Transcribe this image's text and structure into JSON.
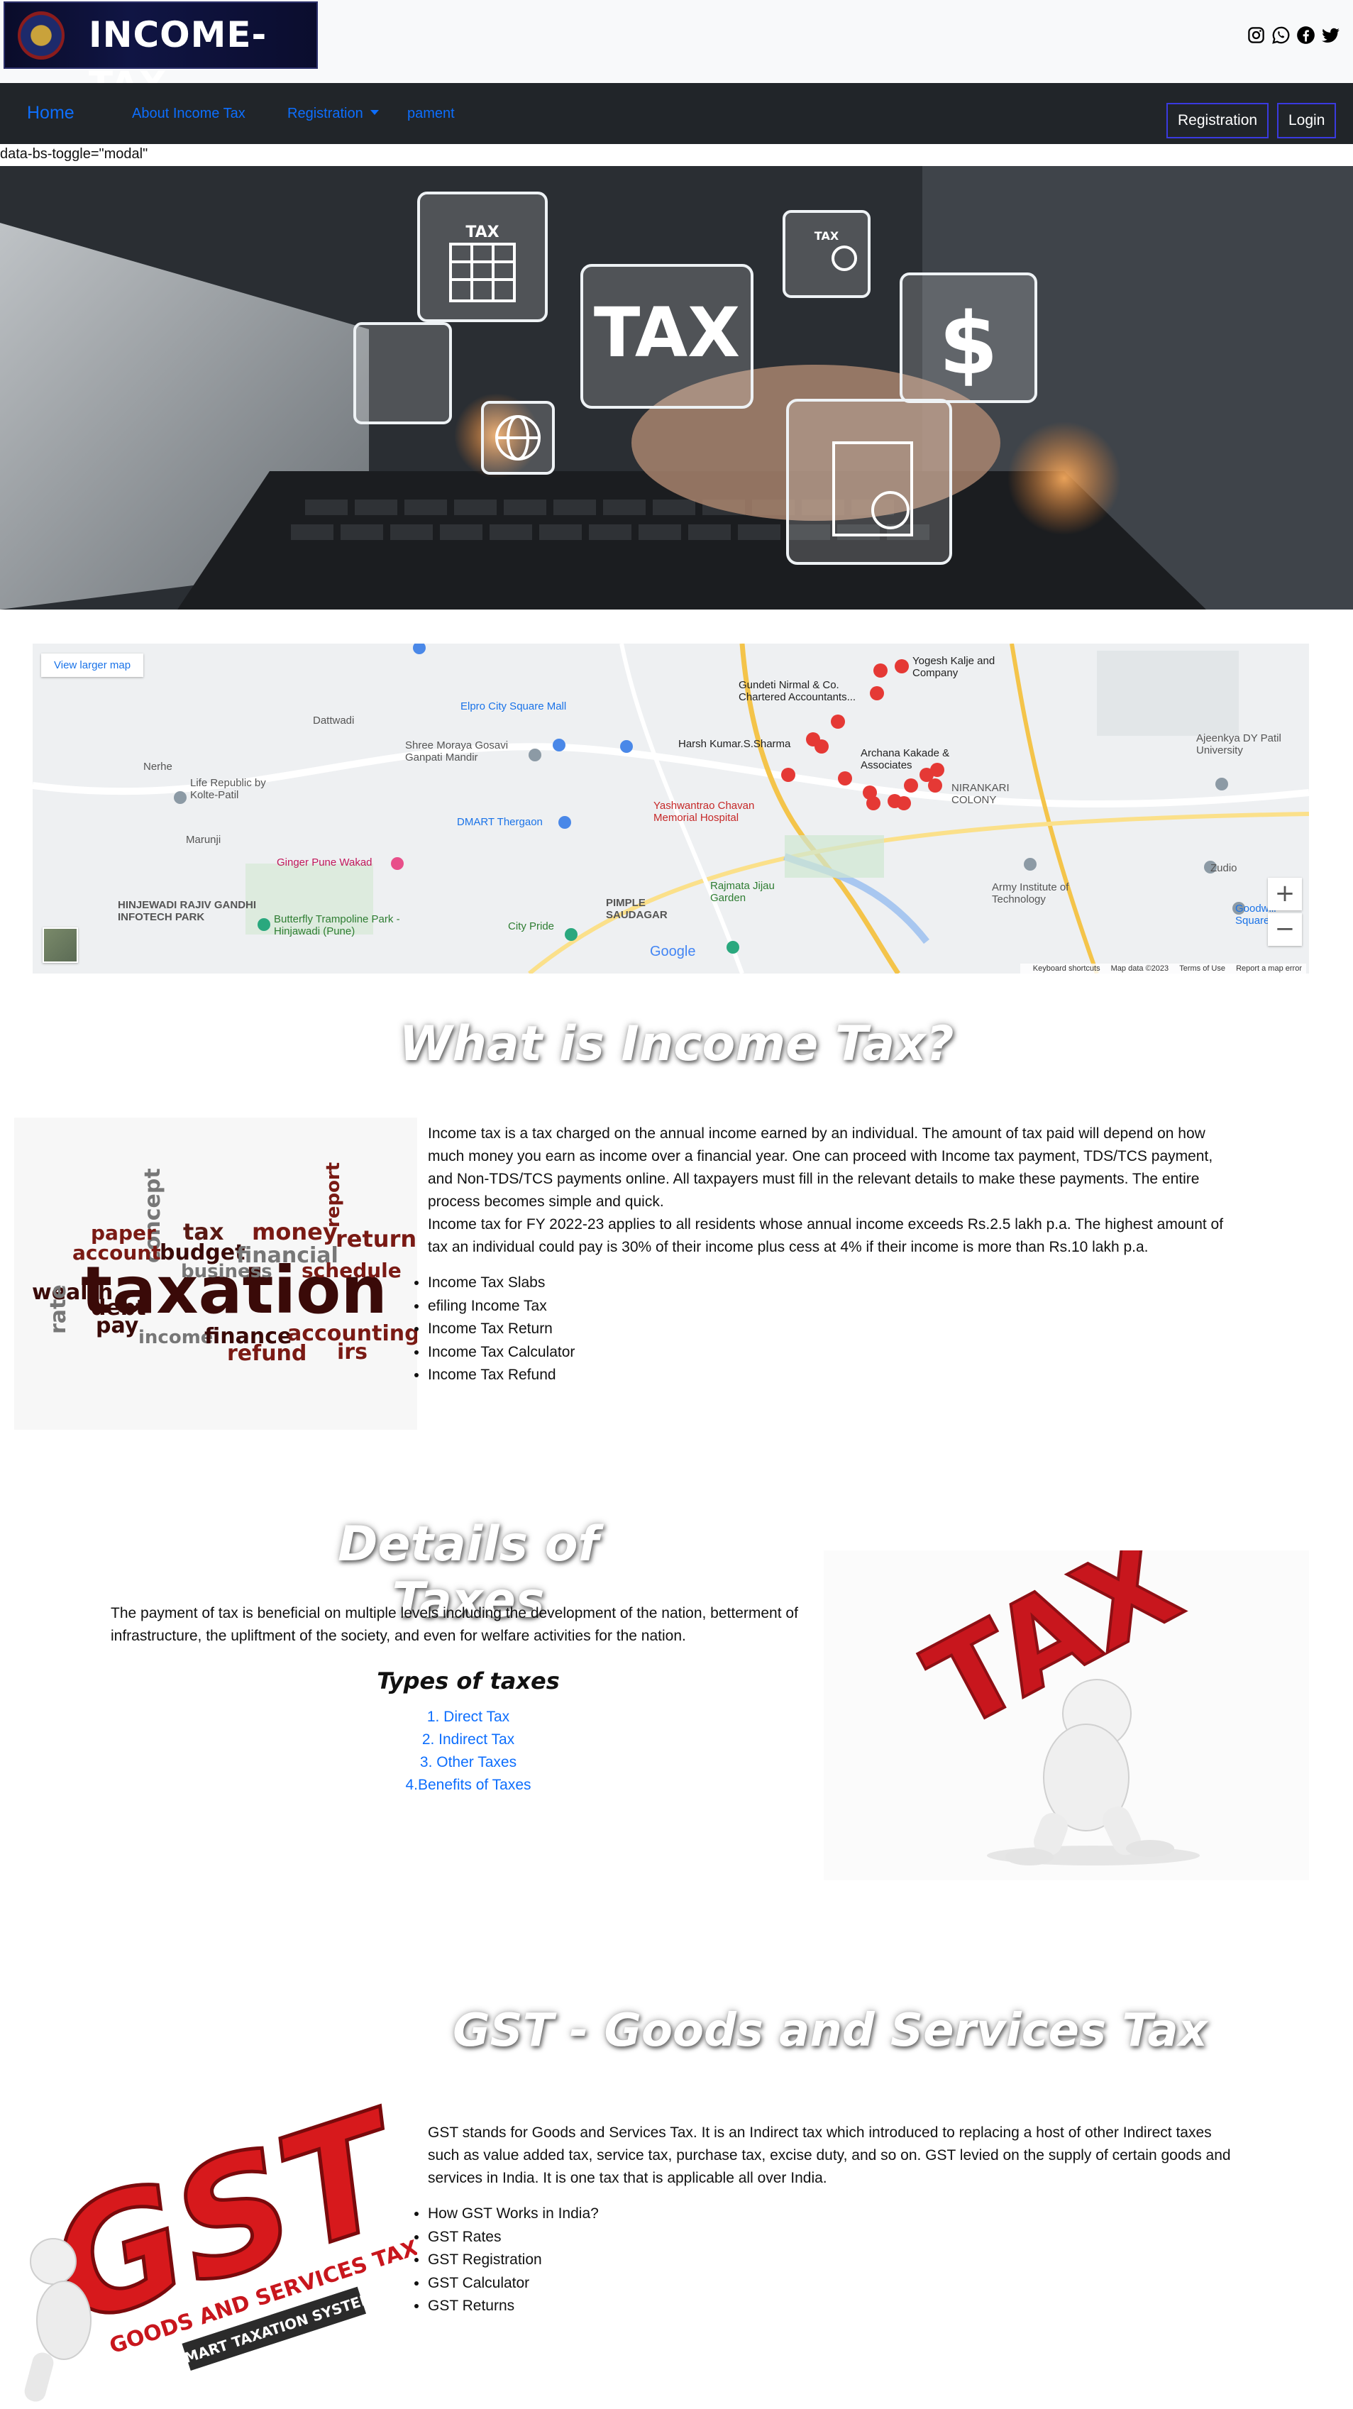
{
  "header": {
    "logo_text": "INCOME-TAX",
    "social_icons": [
      "instagram-icon",
      "whatsapp-icon",
      "facebook-icon",
      "twitter-icon"
    ]
  },
  "nav": {
    "home": "Home",
    "about": "About Income Tax",
    "registration": "Registration",
    "payment": "pament",
    "register_button": "Registration",
    "login_button": "Login"
  },
  "stray_text": "data-bs-toggle=\"modal\"",
  "hero": {
    "icon_labels": [
      "TAX",
      "TAX",
      "TAX",
      "$"
    ]
  },
  "map": {
    "view_larger": "View larger map",
    "labels": [
      "Dattwadi",
      "Nerhe",
      "Life Republic by Kolte-Patil",
      "Marunji",
      "HINJEWADI RAJIV GANDHI INFOTECH PARK",
      "Ginger Pune Wakad",
      "DMART Thergaon",
      "Elpro City Square Mall",
      "Shree Moraya Gosavi Ganpati Mandir",
      "Harsh Kumar.S.Sharma",
      "Gundeti Nirmal & Co. Chartered Accountants...",
      "Yogesh Kalje and Company",
      "Archana Kakade & Associates",
      "Yashwantrao Chavan Memorial Hospital",
      "PIMPLE SAUDAGAR",
      "Rajmata Jijau Garden",
      "City Pride",
      "Butterfly Trampoline Park - Hinjawadi (Pune)",
      "NIRANKARI COLONY",
      "Ajeenkya DY Patil University",
      "Army Institute of Technology",
      "Zudio",
      "Goodwill Square"
    ],
    "footer": [
      "Keyboard shortcuts",
      "Map data ©2023",
      "Terms of Use",
      "Report a map error"
    ],
    "zoom_in": "+",
    "zoom_out": "−",
    "brand": "Google"
  },
  "income_tax": {
    "title": "What is Income Tax?",
    "paragraph1": "Income tax is a tax charged on the annual income earned by an individual. The amount of tax paid will depend on how much money you earn as income over a financial year. One can proceed with Income tax payment, TDS/TCS payment, and Non-TDS/TCS payments online. All taxpayers must fill in the relevant details to make these payments. The entire process becomes simple and quick.",
    "paragraph2": "Income tax for FY 2022-23 applies to all residents whose annual income exceeds Rs.2.5 lakh p.a. The highest amount of tax an individual could pay is 30% of their income plus cess at 4% if their income is more than Rs.10 lakh p.a.",
    "items": [
      "Income Tax Slabs",
      "efiling Income Tax",
      "Income Tax Return",
      "Income Tax Calculator",
      "Income Tax Refund"
    ],
    "image_words": [
      "taxation",
      "money",
      "tax",
      "budget",
      "financial",
      "return",
      "report",
      "concept",
      "paper",
      "account",
      "business",
      "schedule",
      "wealth",
      "debt",
      "pay",
      "income",
      "finance",
      "accounting",
      "refund",
      "irs",
      "rate"
    ]
  },
  "details": {
    "title": "Details of Taxes",
    "paragraph": "The payment of tax is beneficial on multiple levels including the development of the nation, betterment of infrastructure, the upliftment of the society, and even for welfare activities for the nation.",
    "types_title": "Types of taxes",
    "types": [
      "1. Direct Tax",
      "2. Indirect Tax",
      "3. Other Taxes",
      "4.Benefits of Taxes"
    ],
    "image_text": "TAX"
  },
  "gst": {
    "title": "GST - Goods and Services Tax",
    "paragraph": "GST stands for Goods and Services Tax. It is an Indirect tax which introduced to replacing a host of other Indirect taxes such as value added tax, service tax, purchase tax, excise duty, and so on. GST levied on the supply of certain goods and services in India. It is one tax that is applicable all over India.",
    "items": [
      "How GST Works in India?",
      "GST Rates",
      "GST Registration",
      "GST Calculator",
      "GST Returns"
    ],
    "image_text": "GST",
    "image_subtext": "GOODS AND SERVICES TAX",
    "image_tagline": "SMART TAXATION SYSTEM"
  },
  "colors": {
    "navbar": "#212529",
    "link": "#0d6efd",
    "topbar": "#f8f9fa",
    "gst_red": "#d7191c"
  }
}
